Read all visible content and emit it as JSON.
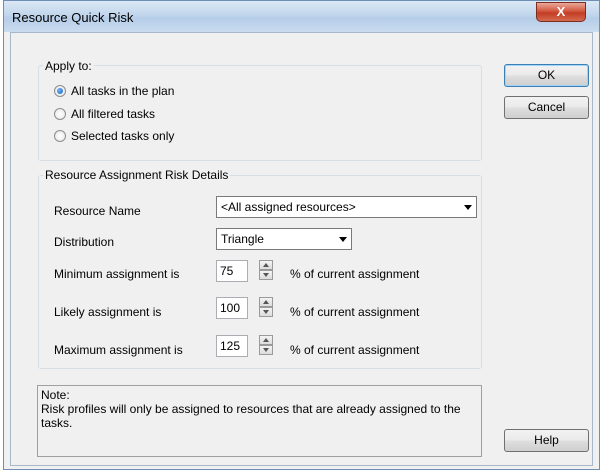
{
  "window": {
    "title": "Resource Quick Risk",
    "close_glyph": "X"
  },
  "apply_to": {
    "label": "Apply to:",
    "options": [
      {
        "label": "All tasks in the plan",
        "checked": true
      },
      {
        "label": "All filtered tasks",
        "checked": false
      },
      {
        "label": "Selected tasks only",
        "checked": false
      }
    ]
  },
  "details": {
    "label": "Resource Assignment Risk Details",
    "resource_name_label": "Resource Name",
    "resource_name_value": "<All assigned resources>",
    "distribution_label": "Distribution",
    "distribution_value": "Triangle",
    "minimum_label": "Minimum assignment is",
    "minimum_value": "75",
    "likely_label": "Likely assignment is",
    "likely_value": "100",
    "maximum_label": "Maximum assignment is",
    "maximum_value": "125",
    "suffix": "% of current assignment"
  },
  "buttons": {
    "ok": "OK",
    "cancel": "Cancel",
    "help": "Help"
  },
  "note": {
    "heading": "Note:",
    "text": "Risk profiles will only be assigned to resources that are already assigned to the tasks."
  }
}
